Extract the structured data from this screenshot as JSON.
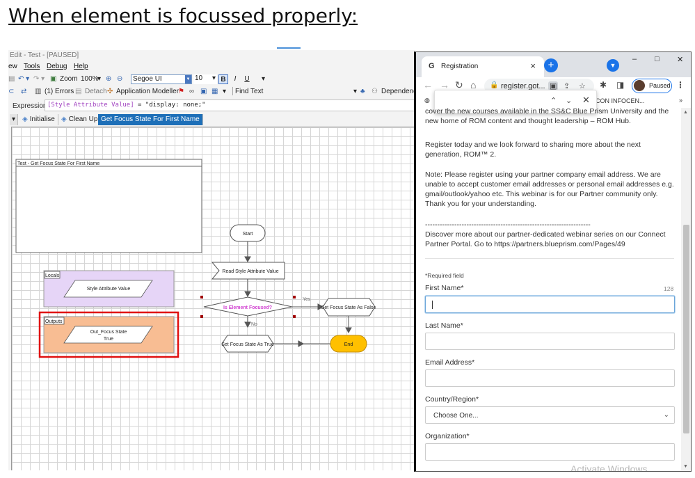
{
  "heading": "When element is focussed properly:",
  "blueprism": {
    "title": "Edit - Test - [PAUSED]",
    "menu": [
      "ew",
      "Tools",
      "Debug",
      "Help"
    ],
    "toolbar1": {
      "zoom_label": "Zoom",
      "zoom_value": "100%",
      "font": "Segoe UI",
      "font_size": "10",
      "bold": "B",
      "italic": "I",
      "underline": "U"
    },
    "toolbar2": {
      "errors": "(1) Errors",
      "detach": "Detach",
      "app_modeller": "Application Modeller",
      "find_text": "Find Text",
      "dependencies": "Dependenci"
    },
    "expression": {
      "label": "Expression:",
      "keyword": "[Style Attribute Value]",
      "rest": " = \"display: none;\""
    },
    "tabs": [
      "Initialise",
      "Clean Up",
      "Get Focus State For First Name"
    ],
    "canvas": {
      "note_title": "Test - Get Focus State For First Name",
      "locals_label": "Locals",
      "locals_item": "Style Attribute Value",
      "outputs_label": "Outputs",
      "outputs_item_line1": "Out_Focus State",
      "outputs_item_line2": "True",
      "start": "Start",
      "read_action": "Read Style Attribute Value",
      "decision": "Is Element Focused?",
      "yes": "Yes",
      "no": "No",
      "set_false": "Set Focus State As False",
      "set_true": "Set Focus State As True",
      "end": "End"
    },
    "colors": {
      "locals_fill": "#e6d5f7",
      "outputs_fill": "#f8bd93",
      "highlight": "#e01010",
      "end_fill": "#ffc000",
      "decision_text": "#d040d0"
    }
  },
  "chrome": {
    "tab_title": "Registration",
    "url": "register.got...",
    "profile": "Paused",
    "bookmark_fragment": "CON INFOCEN...",
    "bookmark_more": "»",
    "window_controls": [
      "–",
      "□",
      "✕"
    ]
  },
  "page": {
    "para1": "cover the new courses available in the SS&C Blue Prism University and the new home of ROM content and thought leadership – ROM Hub.",
    "para2": "Register today and we look forward to sharing more about the next generation, ROM™ 2.",
    "para3": "Note: Please register using your partner company email address. We are unable to accept customer email addresses or personal email addresses e.g. gmail/outlook/yahoo etc. This webinar is for our Partner community only. Thank you for your understanding.",
    "dashes": "--------------------------------------------------------------------",
    "para4": "Discover more about our partner-dedicated webinar series on our Connect Partner Portal. Go to https://partners.blueprism.com/Pages/49",
    "required": "*Required field",
    "first_name": "First Name*",
    "first_name_count": "128",
    "last_name": "Last Name*",
    "email": "Email Address*",
    "country": "Country/Region*",
    "country_value": "Choose One...",
    "organization": "Organization*",
    "watermark": "Activate Windows"
  }
}
